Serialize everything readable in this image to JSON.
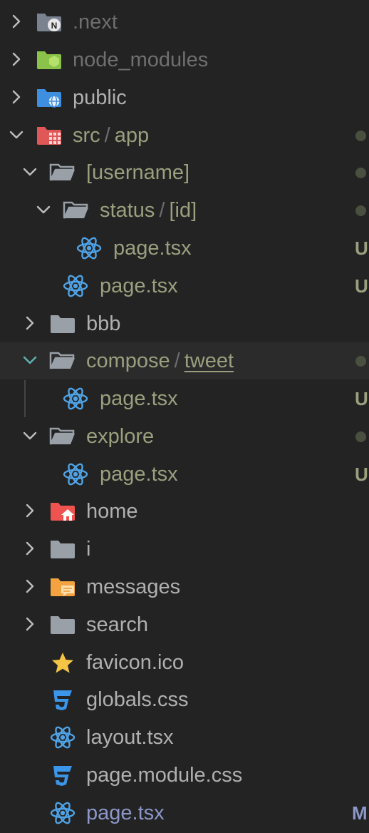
{
  "colors": {
    "background": "#232323",
    "highlight_row": "#2b2b2b",
    "ignored_text": "#6f6f6f",
    "modified_text": "#9aa07e",
    "default_text": "#b0b0b0",
    "tracked_text": "#8c96c8",
    "status_dot": "#4a5040",
    "chevron": "#bdbdbd",
    "chevron_active": "#5fb4b4"
  },
  "tree": [
    {
      "name": "folder-next",
      "label": ".next",
      "icon": "folder-next-icon",
      "chevron": "right"
    },
    {
      "name": "folder-node-modules",
      "label": "node_modules",
      "icon": "folder-node-icon",
      "chevron": "right"
    },
    {
      "name": "folder-public",
      "label": "public",
      "icon": "folder-public-icon",
      "chevron": "right"
    },
    {
      "name": "folder-src-app",
      "label": "src",
      "label2": "app",
      "icon": "folder-src-icon",
      "chevron": "down",
      "dot": true
    },
    {
      "name": "folder-username",
      "label": "[username]",
      "icon": "folder-open-icon",
      "chevron": "down",
      "dot": true
    },
    {
      "name": "folder-status-id",
      "label": "status",
      "label2": "[id]",
      "icon": "folder-open-icon",
      "chevron": "down",
      "dot": true
    },
    {
      "name": "file-status-page",
      "label": "page.tsx",
      "icon": "react-icon",
      "badge": "U"
    },
    {
      "name": "file-username-page",
      "label": "page.tsx",
      "icon": "react-icon",
      "badge": "U"
    },
    {
      "name": "folder-bbb",
      "label": "bbb",
      "icon": "folder-icon",
      "chevron": "right"
    },
    {
      "name": "folder-compose-tweet",
      "label": "compose",
      "label2": "tweet",
      "icon": "folder-open-icon",
      "chevron": "down",
      "dot": true
    },
    {
      "name": "file-compose-page",
      "label": "page.tsx",
      "icon": "react-icon",
      "badge": "U"
    },
    {
      "name": "folder-explore",
      "label": "explore",
      "icon": "folder-open-icon",
      "chevron": "down",
      "dot": true
    },
    {
      "name": "file-explore-page",
      "label": "page.tsx",
      "icon": "react-icon",
      "badge": "U"
    },
    {
      "name": "folder-home",
      "label": "home",
      "icon": "folder-home-icon",
      "chevron": "right"
    },
    {
      "name": "folder-i",
      "label": "i",
      "icon": "folder-icon",
      "chevron": "right"
    },
    {
      "name": "folder-messages",
      "label": "messages",
      "icon": "folder-messages-icon",
      "chevron": "right"
    },
    {
      "name": "folder-search",
      "label": "search",
      "icon": "folder-icon",
      "chevron": "right"
    },
    {
      "name": "file-favicon",
      "label": "favicon.ico",
      "icon": "star-icon"
    },
    {
      "name": "file-globals-css",
      "label": "globals.css",
      "icon": "css-icon"
    },
    {
      "name": "file-layout",
      "label": "layout.tsx",
      "icon": "react-icon"
    },
    {
      "name": "file-page-module-css",
      "label": "page.module.css",
      "icon": "css-icon"
    },
    {
      "name": "file-app-page",
      "label": "page.tsx",
      "icon": "react-icon",
      "badge": "M"
    }
  ]
}
